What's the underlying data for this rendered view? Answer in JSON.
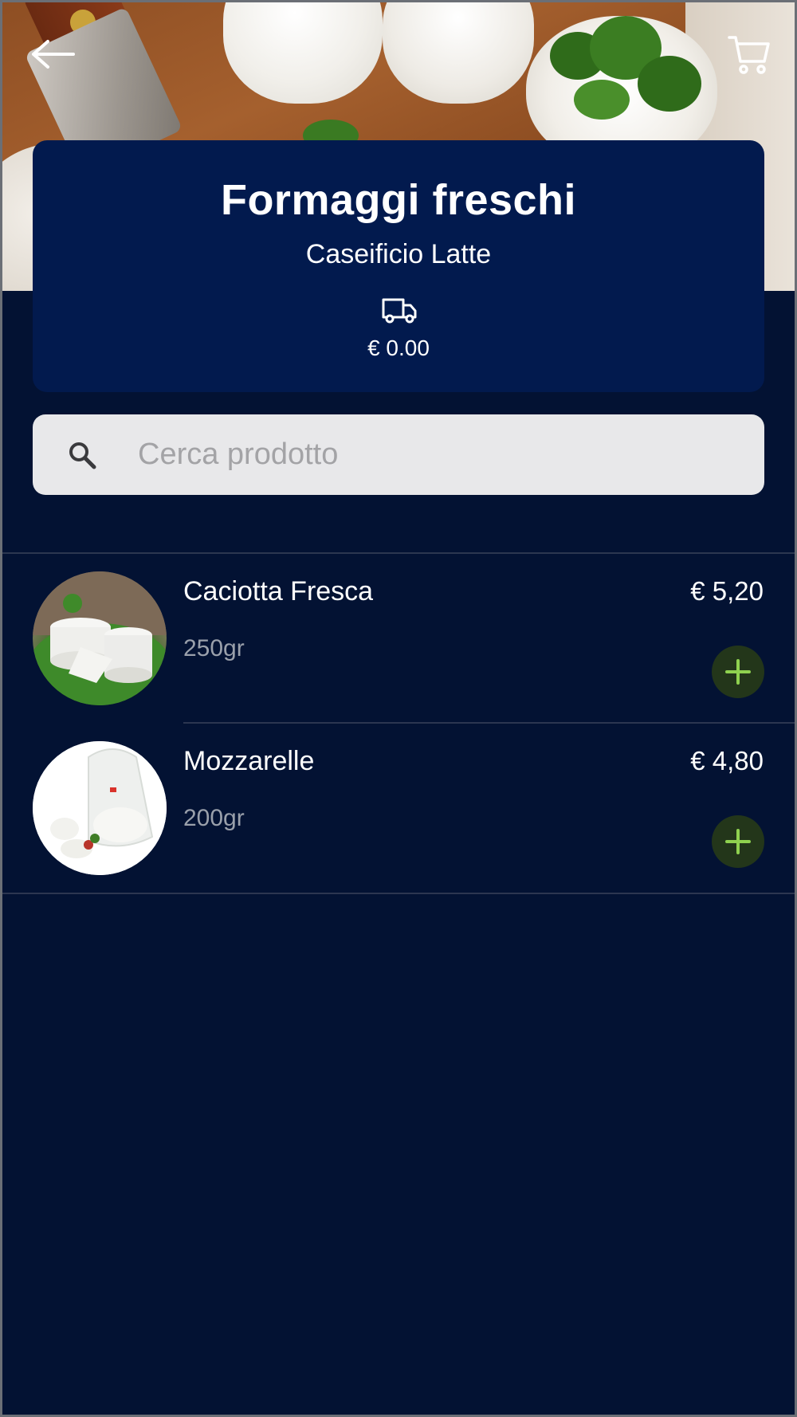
{
  "header": {
    "back_icon": "arrow-left-icon",
    "cart_icon": "shopping-cart-icon"
  },
  "category": {
    "title": "Formaggi freschi",
    "shop_name": "Caseificio Latte",
    "delivery_icon": "truck-icon",
    "delivery_price": "€ 0.00"
  },
  "search": {
    "placeholder": "Cerca prodotto",
    "value": ""
  },
  "products": [
    {
      "name": "Caciotta Fresca",
      "weight": "250gr",
      "price": "€ 5,20"
    },
    {
      "name": "Mozzarelle",
      "weight": "200gr",
      "price": "€ 4,80"
    }
  ],
  "colors": {
    "background": "#031233",
    "card": "#021a4e",
    "search_bg": "#e8e8ea",
    "add_button_bg": "#23361a",
    "add_button_icon": "#8fd14f"
  }
}
